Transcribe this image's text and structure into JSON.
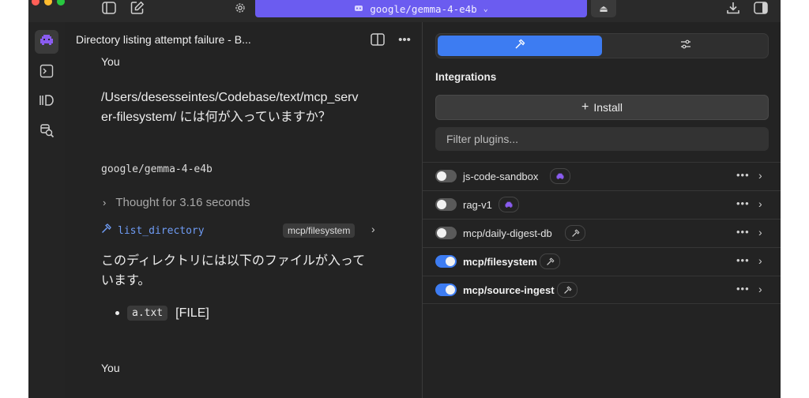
{
  "window": {
    "model_selector": {
      "label": "google/gemma-4-e4b"
    }
  },
  "chat": {
    "title": "Directory listing attempt failure - B...",
    "messages": {
      "user1_role": "You",
      "user1_line1": "/Users/desesseintes/Codebase/text/mcp_serv",
      "user1_line2": "er-filesystem/ には何が入っていますか？",
      "model_name": "google/gemma-4-e4b",
      "thought": "Thought for 3.16 seconds",
      "tool_name": "list_directory",
      "tool_badge": "mcp/filesystem",
      "answer_line1": "このディレクトリには以下のファイルが入って",
      "answer_line2": "います。",
      "file_name": "a.txt",
      "file_type": "[FILE]",
      "user2_role": "You"
    }
  },
  "panel": {
    "section_label": "Integrations",
    "install_label": "Install",
    "filter_placeholder": "Filter plugins...",
    "plugins": [
      {
        "name": "js-code-sandbox",
        "enabled": false,
        "badge_icon": "robot-icon"
      },
      {
        "name": "rag-v1",
        "enabled": false,
        "badge_icon": "robot-icon"
      },
      {
        "name": "mcp/daily-digest-db",
        "enabled": false,
        "badge_icon": "hammer-icon"
      },
      {
        "name": "mcp/filesystem",
        "enabled": true,
        "badge_icon": "hammer-icon"
      },
      {
        "name": "mcp/source-ingest",
        "enabled": true,
        "badge_icon": "hammer-icon"
      }
    ],
    "more_glyph": "•••"
  },
  "colors": {
    "accent_blue": "#3d7cf2",
    "model_purple": "#6b5cf0",
    "robot_purple": "#8a5cf0",
    "tool_blue": "#6f9cf5"
  }
}
